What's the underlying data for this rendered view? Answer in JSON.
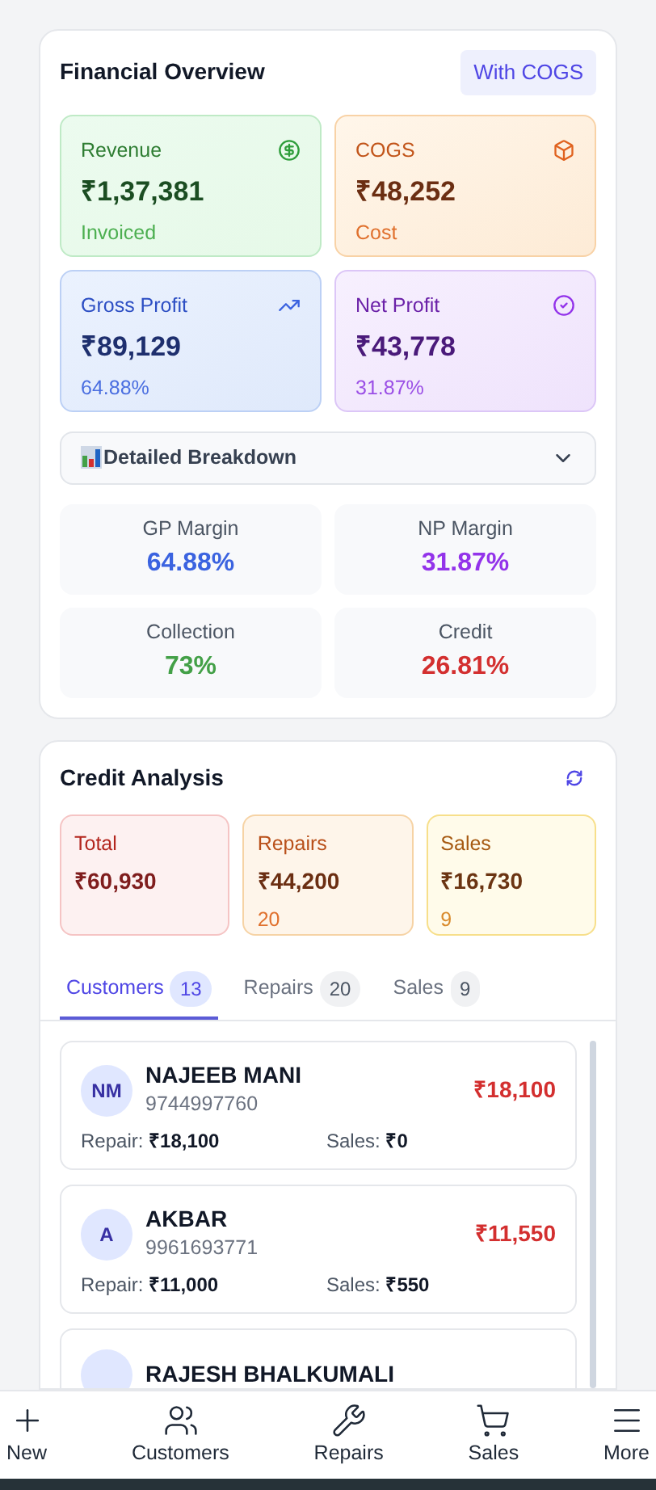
{
  "financial_overview": {
    "title": "Financial Overview",
    "badge": "With COGS",
    "stats": [
      {
        "kind": "revenue",
        "label": "Revenue",
        "value": "₹1,37,381",
        "note": "Invoiced"
      },
      {
        "kind": "cogs",
        "label": "COGS",
        "value": "₹48,252",
        "note": "Cost"
      },
      {
        "kind": "gross",
        "label": "Gross Profit",
        "value": "₹89,129",
        "note": "64.88%"
      },
      {
        "kind": "net",
        "label": "Net Profit",
        "value": "₹43,778",
        "note": "31.87%"
      }
    ],
    "breakdown": {
      "label": "Detailed Breakdown",
      "expanded": true
    },
    "metrics": [
      {
        "label": "GP Margin",
        "value": "64.88%",
        "color": "#3b63e0"
      },
      {
        "label": "NP Margin",
        "value": "31.87%",
        "color": "#9333ea"
      },
      {
        "label": "Collection",
        "value": "73%",
        "color": "#43a047"
      },
      {
        "label": "Credit",
        "value": "26.81%",
        "color": "#d32f2f"
      }
    ]
  },
  "credit_analysis": {
    "title": "Credit Analysis",
    "summary": [
      {
        "kind": "total",
        "label": "Total",
        "value": "₹60,930"
      },
      {
        "kind": "repairs",
        "label": "Repairs",
        "value": "₹44,200",
        "count": "20"
      },
      {
        "kind": "sales",
        "label": "Sales",
        "value": "₹16,730",
        "count": "9"
      }
    ],
    "tabs": [
      {
        "label": "Customers",
        "count": "13",
        "selected": true
      },
      {
        "label": "Repairs",
        "count": "20",
        "selected": false
      },
      {
        "label": "Sales",
        "count": "9",
        "selected": false
      }
    ],
    "customers": [
      {
        "initials": "NM",
        "name": "NAJEEB MANI",
        "phone": "9744997760",
        "amount": "₹18,100",
        "repair_label": "Repair:",
        "repair": "₹18,100",
        "sales_label": "Sales:",
        "sales": "₹0"
      },
      {
        "initials": "A",
        "name": "AKBAR",
        "phone": "9961693771",
        "amount": "₹11,550",
        "repair_label": "Repair:",
        "repair": "₹11,000",
        "sales_label": "Sales:",
        "sales": "₹550"
      },
      {
        "name": "RAJESH BHALKUMALI"
      }
    ]
  },
  "bottom_nav": [
    {
      "kind": "new",
      "label": "New"
    },
    {
      "kind": "customers",
      "label": "Customers"
    },
    {
      "kind": "repairs",
      "label": "Repairs"
    },
    {
      "kind": "sales",
      "label": "Sales"
    },
    {
      "kind": "more",
      "label": "More"
    }
  ]
}
